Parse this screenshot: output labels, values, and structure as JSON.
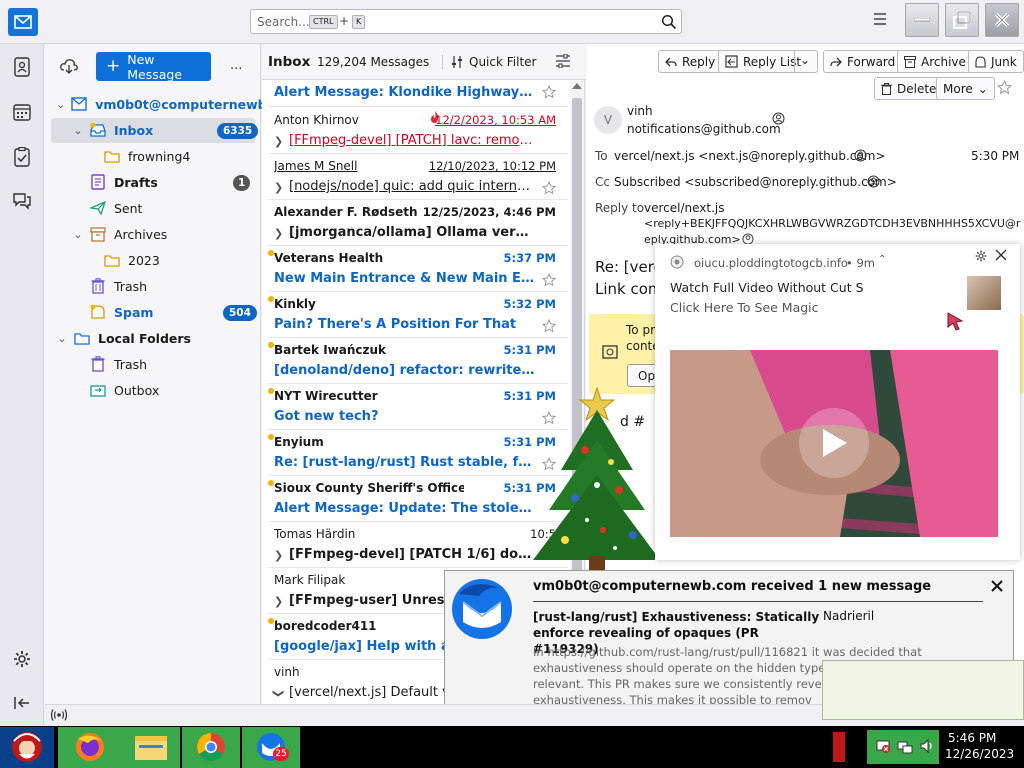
{
  "search": {
    "placeholder": "Search...",
    "key1": "CTRL",
    "plus": "+",
    "key2": "K"
  },
  "folder_pane": {
    "new_message_label": "New Message",
    "more_label": "...",
    "account": "vm0b0t@computernewb....",
    "items": [
      {
        "label": "Inbox",
        "badge": "6335"
      },
      {
        "label": "frowning4"
      },
      {
        "label": "Drafts",
        "badge": "1"
      },
      {
        "label": "Sent"
      },
      {
        "label": "Archives"
      },
      {
        "label": "2023"
      },
      {
        "label": "Trash"
      },
      {
        "label": "Spam",
        "badge": "504"
      },
      {
        "label": "Local Folders"
      },
      {
        "label": "Trash"
      },
      {
        "label": "Outbox"
      }
    ]
  },
  "thread": {
    "folder": "Inbox",
    "count": "129,204 Messages",
    "quick_filter": "Quick Filter",
    "messages": [
      {
        "subject": "Alert Message: Klondike Highway Closed"
      },
      {
        "sender": "Anton Khirnov",
        "date": "12/2/2023, 10:53 AM",
        "subject": "[FFmpeg-devel] [PATCH] lavc: remove the ..."
      },
      {
        "sender": "James M Snell",
        "date": "12/10/2023, 10:12 PM",
        "subject": "[nodejs/node] quic: add quic internalBin..."
      },
      {
        "sender": "Alexander F. Rødseth",
        "date": "12/25/2023, 4:46 PM",
        "subject": "[jmorganca/ollama] Ollama version (..."
      },
      {
        "sender": "Veterans Health",
        "date": "5:37 PM",
        "subject": "New Main Entrance & New Main Entry ..."
      },
      {
        "sender": "Kinkly",
        "date": "5:32 PM",
        "subject": "Pain? There's A Position For That"
      },
      {
        "sender": "Bartek Iwańczuk",
        "date": "5:31 PM",
        "subject": "[denoland/deno] refactor: rewrite rema..."
      },
      {
        "sender": "NYT Wirecutter",
        "date": "5:31 PM",
        "subject": "Got new tech?"
      },
      {
        "sender": "Enyium",
        "date": "5:31 PM",
        "subject": "Re: [rust-lang/rust] Rust stable, fatal ru..."
      },
      {
        "sender": "Sioux County Sheriff's Office",
        "date": "5:31 PM",
        "subject": "Alert Message: Update: The stolen gree..."
      },
      {
        "sender": "Tomas Härdin",
        "date": "10:5",
        "subject": "[FFmpeg-devel] [PATCH 1/6] doc/..."
      },
      {
        "sender": "Mark Filipak",
        "subject": "[FFmpeg-user] Unresolve"
      },
      {
        "sender": "boredcoder411",
        "subject": "[google/jax] Help with aarc"
      },
      {
        "sender": "vinh",
        "subject": "[vercel/next.js] Default valu"
      }
    ]
  },
  "message": {
    "buttons": {
      "reply": "Reply",
      "reply_list": "Reply List",
      "forward": "Forward",
      "archive": "Archive",
      "junk": "Junk",
      "delete": "Delete",
      "more": "More"
    },
    "avatar_letter": "V",
    "from_name": "vinh",
    "from_email": "notifications@github.com",
    "to_label": "To",
    "to_value": "vercel/next.js <next.js@noreply.github.com>",
    "time": "5:30 PM",
    "cc_label": "Cc",
    "cc_value": "Subscribed <subscribed@noreply.github.com>",
    "reply_to_label": "Reply to",
    "reply_to_l1": "vercel/next.js",
    "reply_to_l2": "<reply+BEKJFFQQJKCXHRLWBGVWRZGDTCDH3EVBNHHHS5XCVU@r",
    "reply_to_l3": "eply.github.com>",
    "subject_partial": "Re: [verc",
    "link_partial": "Link com",
    "banner_l1": "To pr",
    "banner_l2": "conte",
    "banner_btn": "Op",
    "body_partial": "d #"
  },
  "ad": {
    "domain": "oiucu.ploddingtotogcb.info",
    "age": "• 9m",
    "title": "Watch Full Video Without Cut S",
    "cta": "Click Here To See Magic"
  },
  "notification": {
    "title": "vm0b0t@computernewb.com received 1 new message",
    "subject": "[rust-lang/rust] Exhaustiveness: Statically enforce revealing of opaques (PR #119329)",
    "from": "Nadrieril",
    "body": "In https://github.com/rust-lang/rust/pull/116821 it was decided that exhaustiveness should operate on the hidden type of an opaque type when relevant. This PR makes sure we consistently reveal opaques within exhaustiveness. This makes it possible to remov"
  },
  "taskbar": {
    "time": "5:46 PM",
    "date": "12/26/2023",
    "mail_badge": "25"
  },
  "colors": {
    "accent": "#0d70d9",
    "unread": "#0d66c7",
    "badge_blue": "#0d66c7",
    "spam_badge": "#0d66c7"
  }
}
